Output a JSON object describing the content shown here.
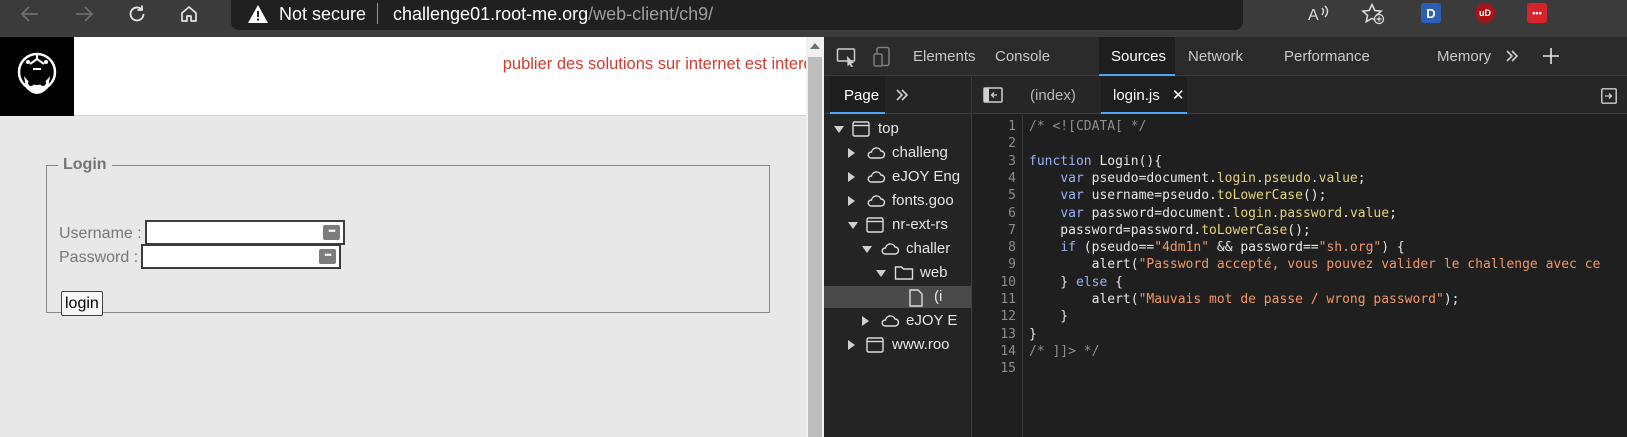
{
  "browser": {
    "security_label": "Not secure",
    "url_host": "challenge01.root-me.org",
    "url_path": "/web-client/ch9/",
    "extensions": [
      {
        "name": "D",
        "color": "#2d5fb8"
      },
      {
        "name": "uD",
        "color": "#a5141a"
      },
      {
        "name": "•••",
        "color": "#d8232a"
      }
    ]
  },
  "page": {
    "banner": "publier des solutions sur internet est interdit",
    "form": {
      "legend": "Login",
      "username_label": "Username :",
      "password_label": "Password :",
      "username_value": "",
      "password_value": "",
      "submit_label": "login"
    }
  },
  "devtools": {
    "tabs": [
      "Elements",
      "Console",
      "Sources",
      "Network",
      "Performance",
      "Memory"
    ],
    "active_tab": "Sources",
    "navigator": {
      "tab_label": "Page",
      "tree": [
        {
          "label": "top",
          "icon": "frame-icon",
          "arrow": "down",
          "level": 0
        },
        {
          "label": "challeng",
          "icon": "cloud-icon",
          "arrow": "right",
          "level": 1
        },
        {
          "label": "eJOY Eng",
          "icon": "cloud-icon",
          "arrow": "right",
          "level": 1
        },
        {
          "label": "fonts.goo",
          "icon": "cloud-icon",
          "arrow": "right",
          "level": 1
        },
        {
          "label": "nr-ext-rs",
          "icon": "frame-icon",
          "arrow": "down",
          "level": 1
        },
        {
          "label": "challer",
          "icon": "cloud-icon",
          "arrow": "down",
          "level": 2
        },
        {
          "label": "web",
          "icon": "folder-icon",
          "arrow": "down",
          "level": 3
        },
        {
          "label": "(i",
          "icon": "file-icon",
          "arrow": "",
          "level": 4,
          "selected": true
        },
        {
          "label": "eJOY E",
          "icon": "cloud-icon",
          "arrow": "right",
          "level": 2
        },
        {
          "label": "www.roo",
          "icon": "frame-icon",
          "arrow": "right",
          "level": 1
        }
      ]
    },
    "editor": {
      "tabs": [
        "(index)",
        "login.js"
      ],
      "active_file": "login.js",
      "line_numbers": [
        "1",
        "2",
        "3",
        "4",
        "5",
        "6",
        "7",
        "8",
        "9",
        "10",
        "11",
        "12",
        "13",
        "14",
        "15"
      ],
      "lines": [
        [
          {
            "t": "/* <![CDATA[ */",
            "c": "cm"
          }
        ],
        [],
        [
          {
            "t": "function",
            "c": "kw"
          },
          {
            "t": " Login(){",
            "c": "pl"
          }
        ],
        [
          {
            "t": "    ",
            "c": "pl"
          },
          {
            "t": "var",
            "c": "kw"
          },
          {
            "t": " pseudo=document.",
            "c": "pl"
          },
          {
            "t": "login",
            "c": "prop"
          },
          {
            "t": ".",
            "c": "pl"
          },
          {
            "t": "pseudo",
            "c": "prop"
          },
          {
            "t": ".",
            "c": "pl"
          },
          {
            "t": "value",
            "c": "prop"
          },
          {
            "t": ";",
            "c": "pl"
          }
        ],
        [
          {
            "t": "    ",
            "c": "pl"
          },
          {
            "t": "var",
            "c": "kw"
          },
          {
            "t": " username=pseudo.",
            "c": "pl"
          },
          {
            "t": "toLowerCase",
            "c": "prop"
          },
          {
            "t": "();",
            "c": "pl"
          }
        ],
        [
          {
            "t": "    ",
            "c": "pl"
          },
          {
            "t": "var",
            "c": "kw"
          },
          {
            "t": " password=document.",
            "c": "pl"
          },
          {
            "t": "login",
            "c": "prop"
          },
          {
            "t": ".",
            "c": "pl"
          },
          {
            "t": "password",
            "c": "prop"
          },
          {
            "t": ".",
            "c": "pl"
          },
          {
            "t": "value",
            "c": "prop"
          },
          {
            "t": ";",
            "c": "pl"
          }
        ],
        [
          {
            "t": "    password=password.",
            "c": "pl"
          },
          {
            "t": "toLowerCase",
            "c": "prop"
          },
          {
            "t": "();",
            "c": "pl"
          }
        ],
        [
          {
            "t": "    ",
            "c": "pl"
          },
          {
            "t": "if",
            "c": "kw"
          },
          {
            "t": " (pseudo==",
            "c": "pl"
          },
          {
            "t": "\"4dm1n\"",
            "c": "str"
          },
          {
            "t": " && password==",
            "c": "pl"
          },
          {
            "t": "\"sh.org\"",
            "c": "str"
          },
          {
            "t": ") {",
            "c": "pl"
          }
        ],
        [
          {
            "t": "        alert(",
            "c": "pl"
          },
          {
            "t": "\"Password accepté, vous pouvez valider le challenge avec ce",
            "c": "str"
          }
        ],
        [
          {
            "t": "    } ",
            "c": "pl"
          },
          {
            "t": "else",
            "c": "kw"
          },
          {
            "t": " {",
            "c": "pl"
          }
        ],
        [
          {
            "t": "        alert(",
            "c": "pl"
          },
          {
            "t": "\"Mauvais mot de passe / wrong password\"",
            "c": "str"
          },
          {
            "t": ");",
            "c": "pl"
          }
        ],
        [
          {
            "t": "    }",
            "c": "pl"
          }
        ],
        [
          {
            "t": "}",
            "c": "pl"
          }
        ],
        [
          {
            "t": "/* ]]> */",
            "c": "cm"
          }
        ],
        []
      ]
    }
  }
}
